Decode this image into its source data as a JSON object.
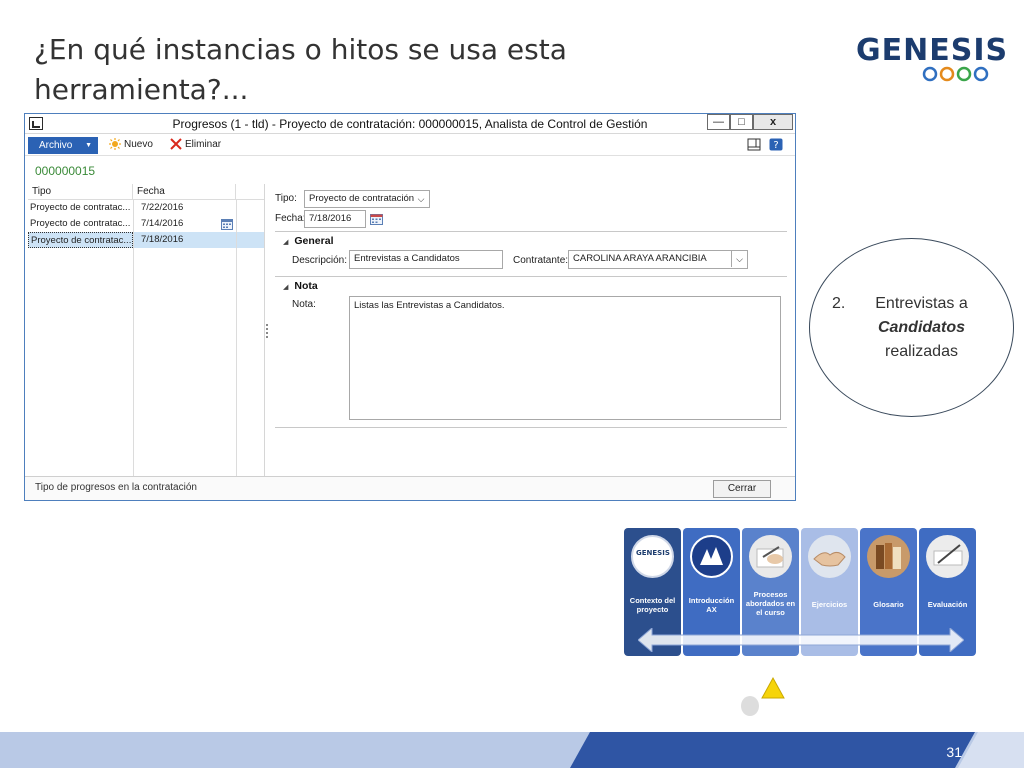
{
  "slide": {
    "title": "¿En qué instancias o hitos se usa esta herramienta?...",
    "page_number": "31"
  },
  "logo": {
    "text": "GENESIS"
  },
  "window": {
    "title": "Progresos (1 - tld) - Proyecto de contratación: 000000015, Analista de Control de Gestión",
    "controls": {
      "minimize": "—",
      "restore": "□",
      "close": "x"
    }
  },
  "toolbar": {
    "archivo": "Archivo",
    "nuevo": "Nuevo",
    "eliminar": "Eliminar"
  },
  "record_id": "000000015",
  "grid": {
    "headers": {
      "tipo": "Tipo",
      "fecha": "Fecha"
    },
    "rows": [
      {
        "tipo": "Proyecto de contratac...",
        "fecha": "7/22/2016"
      },
      {
        "tipo": "Proyecto de contratac...",
        "fecha": "7/14/2016"
      },
      {
        "tipo": "Proyecto de contratac...",
        "fecha": "7/18/2016"
      }
    ]
  },
  "form": {
    "tipo_label": "Tipo:",
    "tipo_value": "Proyecto de contratación",
    "fecha_label": "Fecha:",
    "fecha_value": "7/18/2016",
    "general_header": "General",
    "descripcion_label": "Descripción:",
    "descripcion_value": "Entrevistas a Candidatos",
    "contratante_label": "Contratante:",
    "contratante_value": "CAROLINA ARAYA ARANCIBIA",
    "nota_header": "Nota",
    "nota_label": "Nota:",
    "nota_value": "Listas las Entrevistas a Candidatos."
  },
  "status": {
    "text": "Tipo de progresos en la contratación",
    "close_button": "Cerrar"
  },
  "callout": {
    "number": "2.",
    "line1": "Entrevistas a",
    "line2": "Candidatos",
    "line3": "realizadas"
  },
  "nav_tiles": [
    {
      "label": "Contexto del proyecto",
      "color": "#2c4f8d"
    },
    {
      "label": "Introducción AX",
      "color": "#3f6cc2"
    },
    {
      "label": "Procesos abordados en el curso",
      "color": "#5a82cc"
    },
    {
      "label": "Ejercicios",
      "color": "#a9bde6"
    },
    {
      "label": "Glosario",
      "color": "#4a74c9"
    },
    {
      "label": "Evaluación",
      "color": "#3f6cc2"
    }
  ],
  "nav_tile_logo_text": "GENESIS",
  "colors": {
    "accent_blue": "#2b62b4",
    "record_green": "#3a8a38",
    "footer_light": "#b9c9e6",
    "footer_dark": "#2f55a4"
  }
}
